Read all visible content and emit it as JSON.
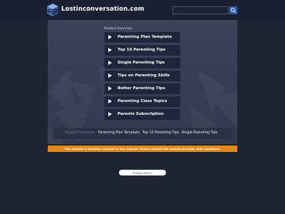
{
  "header": {
    "site_name": "Lostinconversation.com",
    "search": {
      "value": "",
      "placeholder": ""
    },
    "icons": {
      "logo": "cube-logo-icon",
      "search": "search-icon"
    }
  },
  "related": {
    "label": "Related Searches",
    "links": [
      {
        "label": "Parenting Plan Template"
      },
      {
        "label": "Top 10 Parenting Tips"
      },
      {
        "label": "Single Parenting Tips"
      },
      {
        "label": "Tips on Parenting Skills"
      },
      {
        "label": "Better Parenting Tips"
      },
      {
        "label": "Parenting Class Topics"
      },
      {
        "label": "Parents Subscription"
      }
    ]
  },
  "bottom_bar": {
    "label": "Related Searches",
    "links": [
      {
        "label": "Parenting Plan Template"
      },
      {
        "label": "Top 10 Parenting Tips"
      },
      {
        "label": "Single Parenting Tips"
      }
    ]
  },
  "notice": {
    "text": "This domain is pending renewal or has expired. Please contact the domain provider with questions."
  },
  "footer": {
    "privacy_label": "Privacy Policy"
  },
  "colors": {
    "background": "#1f2433",
    "panel": "#3a4358",
    "link_bg": "#20263a",
    "notice": "#e08a1e",
    "search_button": "#2c5fb0"
  }
}
